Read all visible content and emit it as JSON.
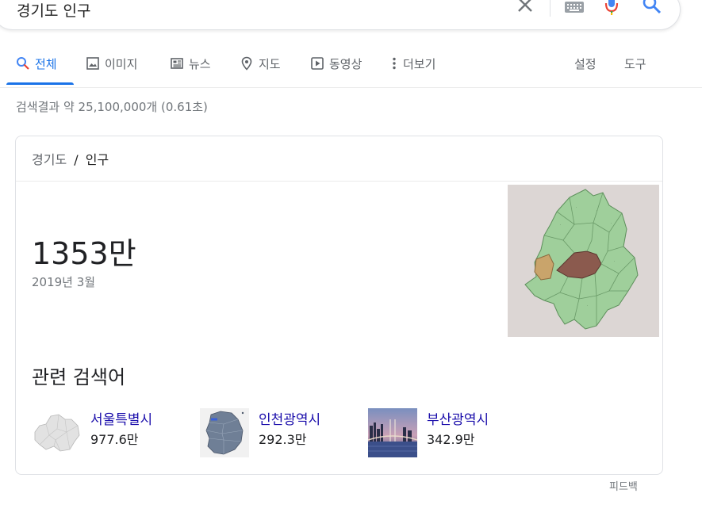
{
  "search": {
    "query": "경기도 인구"
  },
  "icons": {
    "clear": "close-icon",
    "keyboard": "keyboard-icon",
    "mic": "microphone-icon",
    "search": "search-icon"
  },
  "tabs": [
    {
      "label": "전체",
      "icon": "search-icon",
      "active": true
    },
    {
      "label": "이미지",
      "icon": "image-icon"
    },
    {
      "label": "뉴스",
      "icon": "news-icon"
    },
    {
      "label": "지도",
      "icon": "map-pin-icon"
    },
    {
      "label": "동영상",
      "icon": "video-icon"
    },
    {
      "label": "더보기",
      "icon": "more-vert-icon"
    }
  ],
  "tools": {
    "settings": "설정",
    "tools": "도구"
  },
  "result_stats": "검색결과 약 25,100,000개 (0.61초)",
  "card": {
    "breadcrumb": {
      "parent": "경기도",
      "separator": "/",
      "current": "인구"
    },
    "value": "1353만",
    "date": "2019년 3월",
    "related_title": "관련 검색어",
    "related": [
      {
        "name": "서울특별시",
        "value": "977.6만"
      },
      {
        "name": "인천광역시",
        "value": "292.3만"
      },
      {
        "name": "부산광역시",
        "value": "342.9만"
      }
    ]
  },
  "feedback": "피드백",
  "colors": {
    "accent": "#1a73e8",
    "link": "#1a0dab"
  }
}
